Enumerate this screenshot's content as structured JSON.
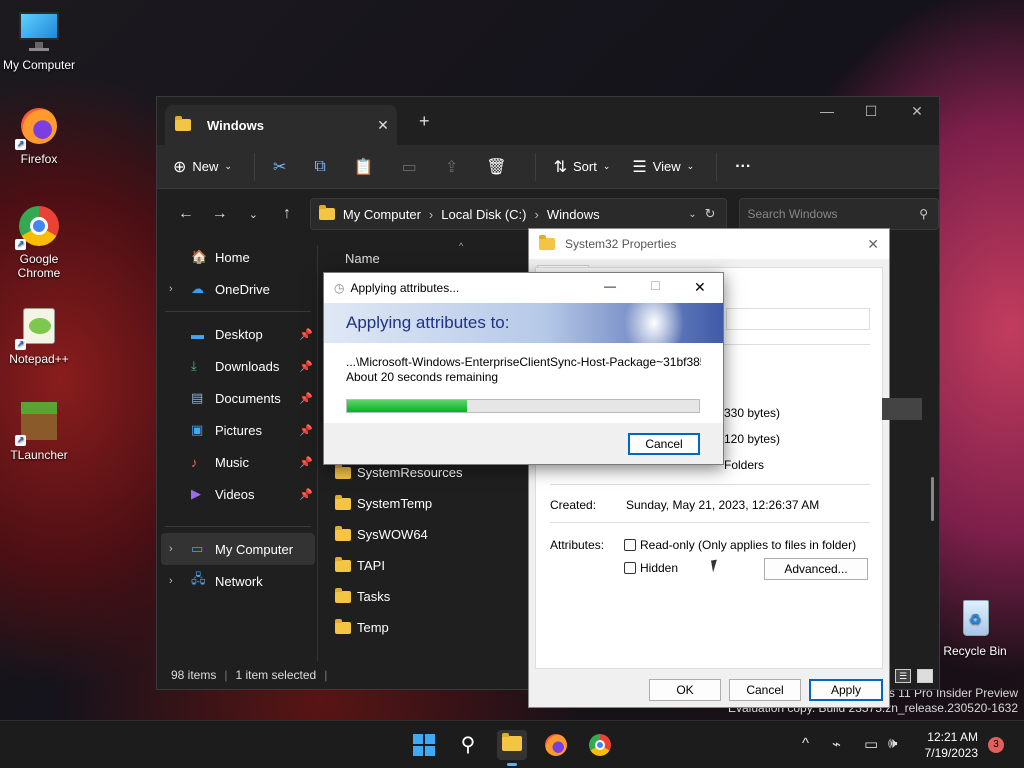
{
  "desktop": {
    "icons": [
      {
        "label": "My Computer"
      },
      {
        "label": "Firefox"
      },
      {
        "label": "Google Chrome"
      },
      {
        "label": "Notepad++"
      },
      {
        "label": "TLauncher"
      },
      {
        "label": "Recycle Bin"
      }
    ],
    "watermark_line1": "ws 11 Pro Insider Preview",
    "watermark_line2": "Evaluation copy. Build 23575.zn_release.230520-1632"
  },
  "explorer": {
    "tab_title": "Windows",
    "toolbar": {
      "new": "New",
      "sort": "Sort",
      "view": "View"
    },
    "breadcrumb": [
      "My Computer",
      "Local Disk (C:)",
      "Windows"
    ],
    "search_placeholder": "Search Windows",
    "sidebar": {
      "home": "Home",
      "onedrive": "OneDrive",
      "desktop": "Desktop",
      "downloads": "Downloads",
      "documents": "Documents",
      "pictures": "Pictures",
      "music": "Music",
      "videos": "Videos",
      "mycomputer": "My Computer",
      "network": "Network"
    },
    "column_name": "Name",
    "files": [
      "SystemResources",
      "SystemTemp",
      "SysWOW64",
      "TAPI",
      "Tasks",
      "Temp"
    ],
    "status_items": "98 items",
    "status_selected": "1 item selected"
  },
  "properties": {
    "title": "System32 Properties",
    "size_partial": "330 bytes)",
    "size_on_disk_partial": "120 bytes)",
    "contains_partial": "Folders",
    "created_label": "Created:",
    "created_value": "Sunday, May 21, 2023, 12:26:37 AM",
    "attributes_label": "Attributes:",
    "readonly_label": "Read-only (Only applies to files in folder)",
    "hidden_label": "Hidden",
    "advanced_button": "Advanced...",
    "ok": "OK",
    "cancel": "Cancel",
    "apply": "Apply"
  },
  "progress_dialog": {
    "title": "Applying attributes...",
    "heading": "Applying attributes to:",
    "path": "...\\Microsoft-Windows-EnterpriseClientSync-Host-Package~31bf385",
    "remaining": "About 20 seconds remaining",
    "progress": 0.34,
    "cancel": "Cancel"
  },
  "taskbar": {
    "time": "12:21 AM",
    "date": "7/19/2023",
    "notification_count": "3"
  }
}
